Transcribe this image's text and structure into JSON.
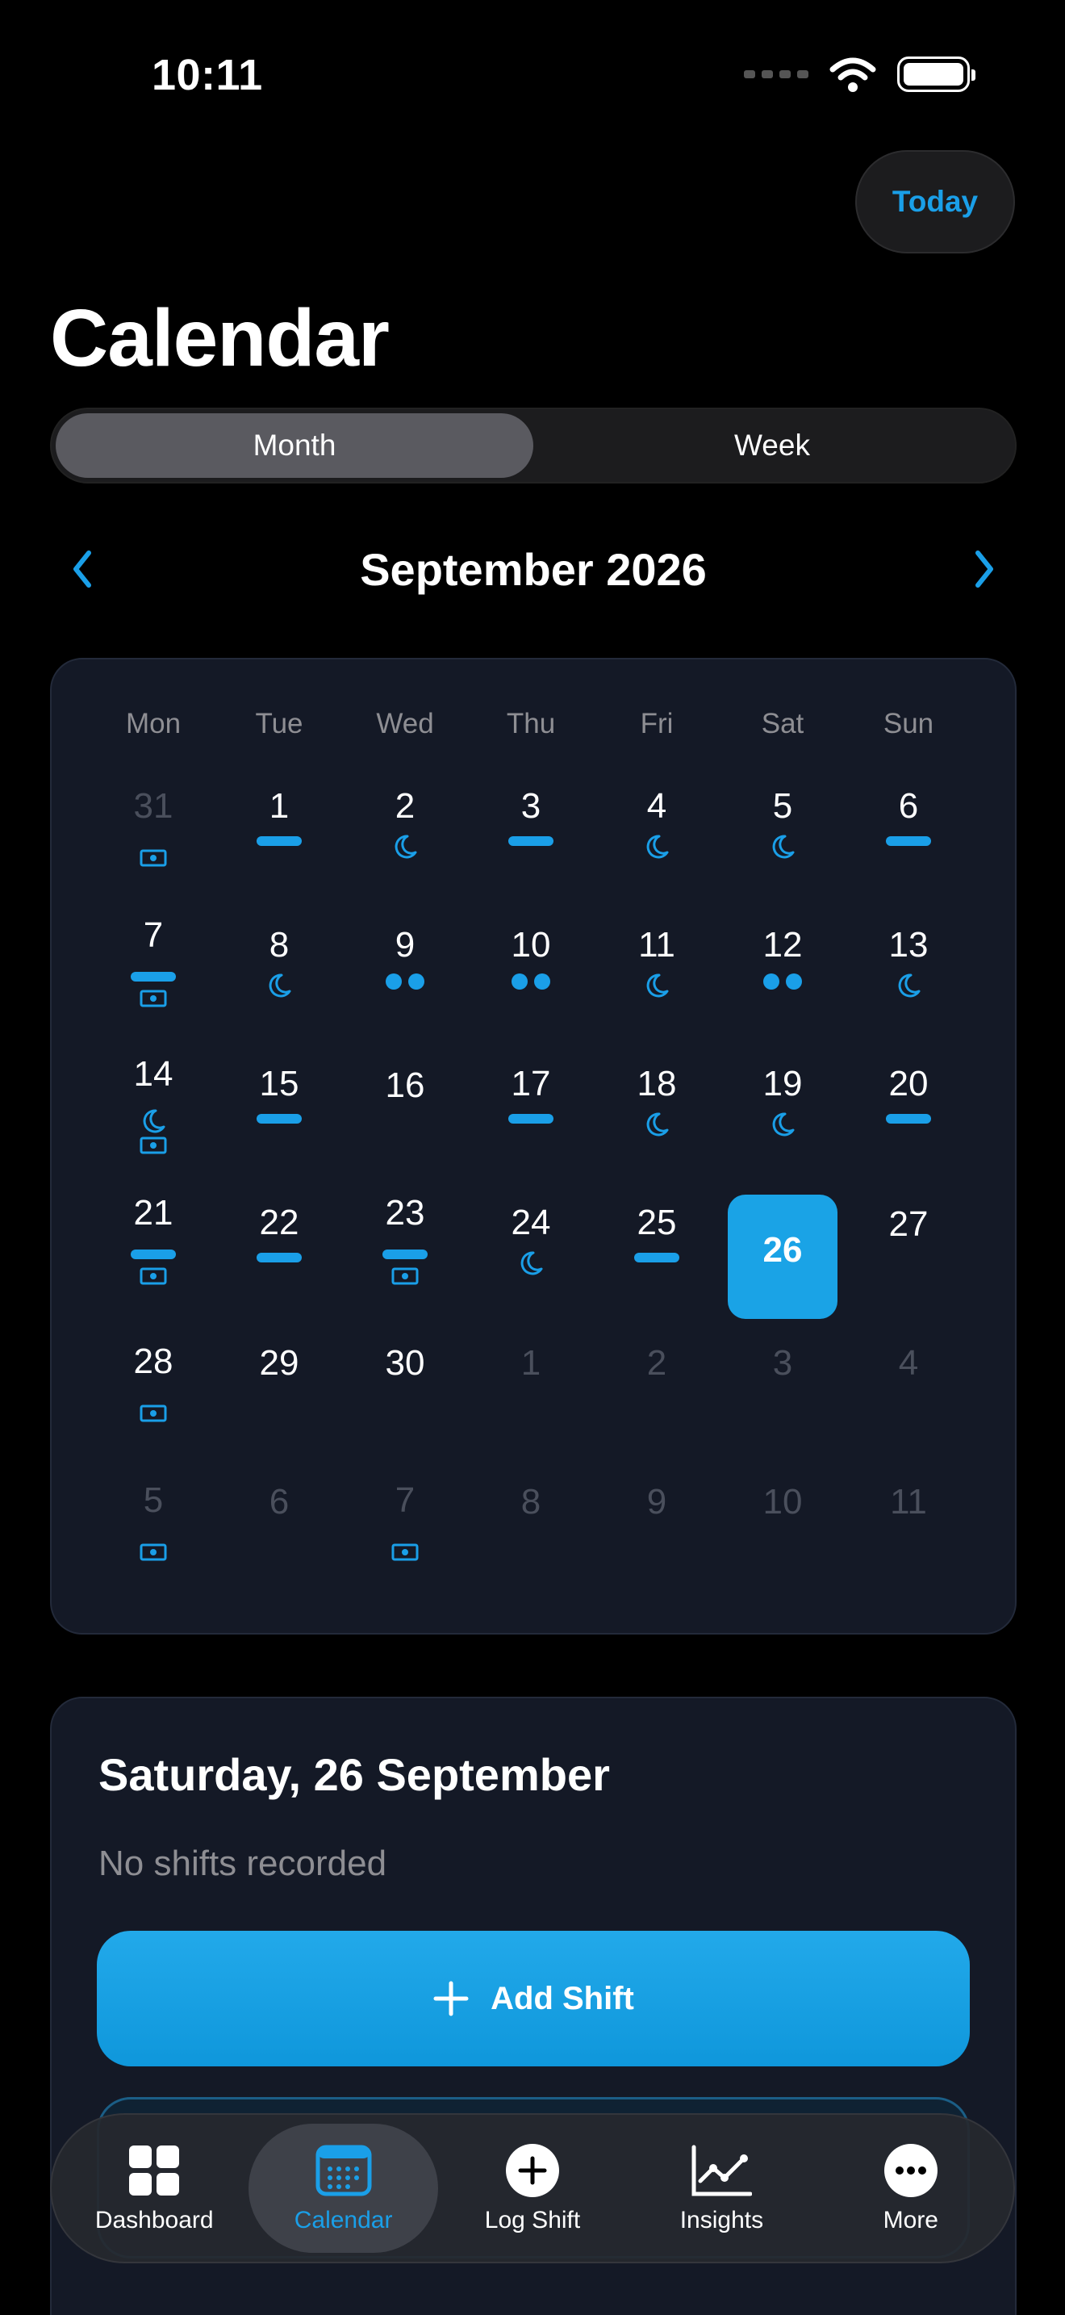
{
  "status": {
    "time": "10:11"
  },
  "header": {
    "today_label": "Today",
    "title": "Calendar"
  },
  "view_switch": {
    "options": [
      "Month",
      "Week"
    ],
    "selected": "Month"
  },
  "month_nav": {
    "title": "September 2026"
  },
  "calendar": {
    "weekdays": [
      "Mon",
      "Tue",
      "Wed",
      "Thu",
      "Fri",
      "Sat",
      "Sun"
    ],
    "selected_day": "26",
    "accent_color": "#1a9fe8",
    "days": [
      {
        "day": "31",
        "muted": true,
        "marks": [
          "cash"
        ]
      },
      {
        "day": "1",
        "muted": false,
        "marks": [
          "bar"
        ]
      },
      {
        "day": "2",
        "muted": false,
        "marks": [
          "moon"
        ]
      },
      {
        "day": "3",
        "muted": false,
        "marks": [
          "bar"
        ]
      },
      {
        "day": "4",
        "muted": false,
        "marks": [
          "moon"
        ]
      },
      {
        "day": "5",
        "muted": false,
        "marks": [
          "moon"
        ]
      },
      {
        "day": "6",
        "muted": false,
        "marks": [
          "bar"
        ]
      },
      {
        "day": "7",
        "muted": false,
        "marks": [
          "bar",
          "cash"
        ]
      },
      {
        "day": "8",
        "muted": false,
        "marks": [
          "moon"
        ]
      },
      {
        "day": "9",
        "muted": false,
        "marks": [
          "dots"
        ]
      },
      {
        "day": "10",
        "muted": false,
        "marks": [
          "dots"
        ]
      },
      {
        "day": "11",
        "muted": false,
        "marks": [
          "moon"
        ]
      },
      {
        "day": "12",
        "muted": false,
        "marks": [
          "dots"
        ]
      },
      {
        "day": "13",
        "muted": false,
        "marks": [
          "moon"
        ]
      },
      {
        "day": "14",
        "muted": false,
        "marks": [
          "moon",
          "cash"
        ]
      },
      {
        "day": "15",
        "muted": false,
        "marks": [
          "bar"
        ]
      },
      {
        "day": "16",
        "muted": false,
        "marks": []
      },
      {
        "day": "17",
        "muted": false,
        "marks": [
          "bar"
        ]
      },
      {
        "day": "18",
        "muted": false,
        "marks": [
          "moon"
        ]
      },
      {
        "day": "19",
        "muted": false,
        "marks": [
          "moon"
        ]
      },
      {
        "day": "20",
        "muted": false,
        "marks": [
          "bar"
        ]
      },
      {
        "day": "21",
        "muted": false,
        "marks": [
          "bar",
          "cash"
        ]
      },
      {
        "day": "22",
        "muted": false,
        "marks": [
          "bar"
        ]
      },
      {
        "day": "23",
        "muted": false,
        "marks": [
          "bar",
          "cash"
        ]
      },
      {
        "day": "24",
        "muted": false,
        "marks": [
          "moon"
        ]
      },
      {
        "day": "25",
        "muted": false,
        "marks": [
          "bar"
        ]
      },
      {
        "day": "26",
        "muted": false,
        "marks": [],
        "selected": true
      },
      {
        "day": "27",
        "muted": false,
        "marks": []
      },
      {
        "day": "28",
        "muted": false,
        "marks": [
          "cash"
        ]
      },
      {
        "day": "29",
        "muted": false,
        "marks": []
      },
      {
        "day": "30",
        "muted": false,
        "marks": []
      },
      {
        "day": "1",
        "muted": true,
        "marks": []
      },
      {
        "day": "2",
        "muted": true,
        "marks": []
      },
      {
        "day": "3",
        "muted": true,
        "marks": []
      },
      {
        "day": "4",
        "muted": true,
        "marks": []
      },
      {
        "day": "5",
        "muted": true,
        "marks": [
          "cash"
        ]
      },
      {
        "day": "6",
        "muted": true,
        "marks": []
      },
      {
        "day": "7",
        "muted": true,
        "marks": [
          "cash"
        ]
      },
      {
        "day": "8",
        "muted": true,
        "marks": []
      },
      {
        "day": "9",
        "muted": true,
        "marks": []
      },
      {
        "day": "10",
        "muted": true,
        "marks": []
      },
      {
        "day": "11",
        "muted": true,
        "marks": []
      }
    ]
  },
  "detail": {
    "title": "Saturday, 26 September",
    "empty_text": "No shifts recorded",
    "add_label": "Add Shift"
  },
  "tabbar": {
    "tabs": [
      {
        "label": "Dashboard",
        "icon": "grid-icon"
      },
      {
        "label": "Calendar",
        "icon": "calendar-icon",
        "active": true
      },
      {
        "label": "Log Shift",
        "icon": "plus-circle-icon"
      },
      {
        "label": "Insights",
        "icon": "line-chart-icon"
      },
      {
        "label": "More",
        "icon": "ellipsis-circle-icon"
      }
    ]
  }
}
